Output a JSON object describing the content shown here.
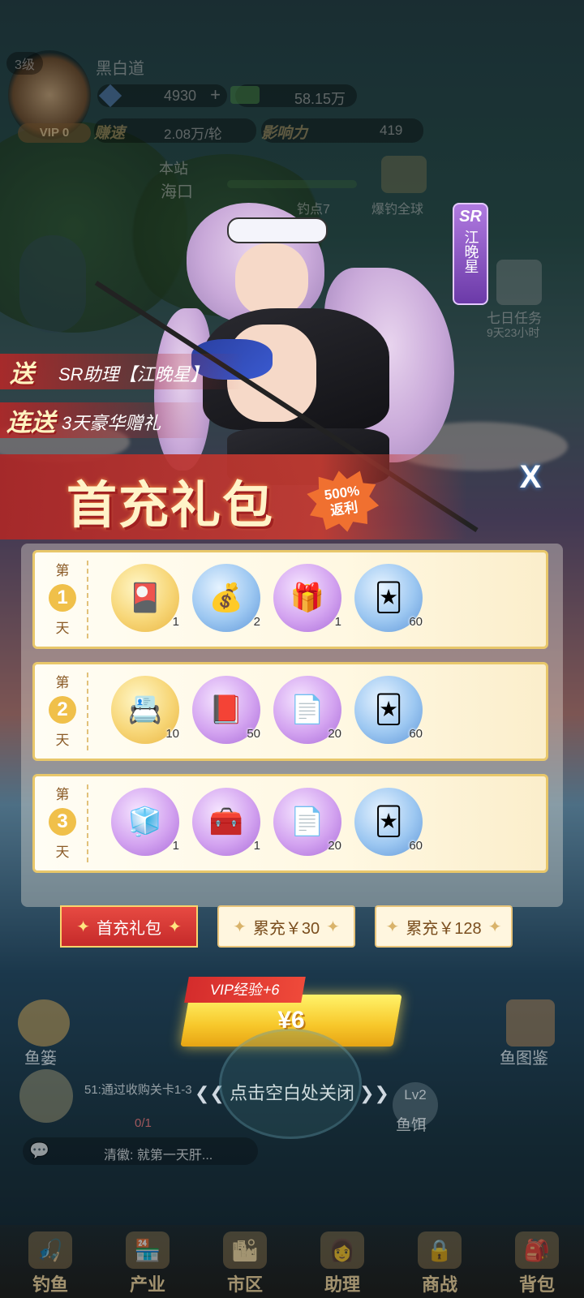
{
  "player": {
    "level": "3级",
    "name": "黑白道",
    "vip": "VIP 0",
    "diamonds": "4930",
    "cash": "58.15万",
    "earn_label": "赚速",
    "earn_value": "2.08万/轮",
    "influence_label": "影响力",
    "influence_value": "419",
    "location_label": "本站",
    "location_value": "海口",
    "spot_label": "钓点7",
    "global_label": "爆钓全球",
    "seven_day_label": "七日任务",
    "seven_day_time": "9天23小时"
  },
  "character": {
    "rarity": "SR",
    "name": "江晚星"
  },
  "promo": {
    "line1_tag": "送",
    "line1_text": "SR助理【江晚星】",
    "line2_tag": "连送",
    "line2_text": "3天豪华赠礼",
    "title": "首充礼包",
    "badge_top": "500%",
    "badge_bottom": "返利",
    "close_symbol": "X"
  },
  "days": [
    {
      "pre": "第",
      "num": "1",
      "post": "天",
      "items": [
        {
          "icon": "assistant-card-icon",
          "color": "gold",
          "count": "1"
        },
        {
          "icon": "money-chest-icon",
          "color": "blue",
          "count": "2"
        },
        {
          "icon": "gift-box-icon",
          "color": "purple",
          "count": "1"
        },
        {
          "icon": "ticket-card-icon",
          "color": "blue",
          "count": "60"
        }
      ]
    },
    {
      "pre": "第",
      "num": "2",
      "post": "天",
      "items": [
        {
          "icon": "character-card-icon",
          "color": "gold",
          "count": "10"
        },
        {
          "icon": "book-icon",
          "color": "purple",
          "count": "50"
        },
        {
          "icon": "paper-icon",
          "color": "purple",
          "count": "20"
        },
        {
          "icon": "ticket-card-icon",
          "color": "blue",
          "count": "60"
        }
      ]
    },
    {
      "pre": "第",
      "num": "3",
      "post": "天",
      "items": [
        {
          "icon": "rubik-cube-icon",
          "color": "purple",
          "count": "1"
        },
        {
          "icon": "treasure-chest-icon",
          "color": "purple",
          "count": "1"
        },
        {
          "icon": "paper-icon",
          "color": "purple",
          "count": "20"
        },
        {
          "icon": "ticket-card-icon",
          "color": "blue",
          "count": "60"
        }
      ]
    }
  ],
  "tabs": [
    {
      "label": "首充礼包",
      "active": true
    },
    {
      "label": "累充￥30",
      "active": false
    },
    {
      "label": "累充￥128",
      "active": false
    }
  ],
  "purchase": {
    "vip_tag": "VIP经验+6",
    "price": "¥6",
    "close_hint": "点击空白处关闭"
  },
  "background": {
    "fish_basket": "鱼篓",
    "fish_guide": "鱼图鉴",
    "task_text": "51:通过收购关卡1-3",
    "task_progress": "0/1",
    "bait_level": "Lv2",
    "bait_label": "鱼饵",
    "chat_text": "清徽: 就第一天肝..."
  },
  "nav": [
    {
      "label": "钓鱼",
      "icon": "fishing-icon"
    },
    {
      "label": "产业",
      "icon": "shop-icon"
    },
    {
      "label": "市区",
      "icon": "city-icon"
    },
    {
      "label": "助理",
      "icon": "assistant-icon"
    },
    {
      "label": "商战",
      "icon": "lock-icon"
    },
    {
      "label": "背包",
      "icon": "backpack-icon"
    }
  ]
}
